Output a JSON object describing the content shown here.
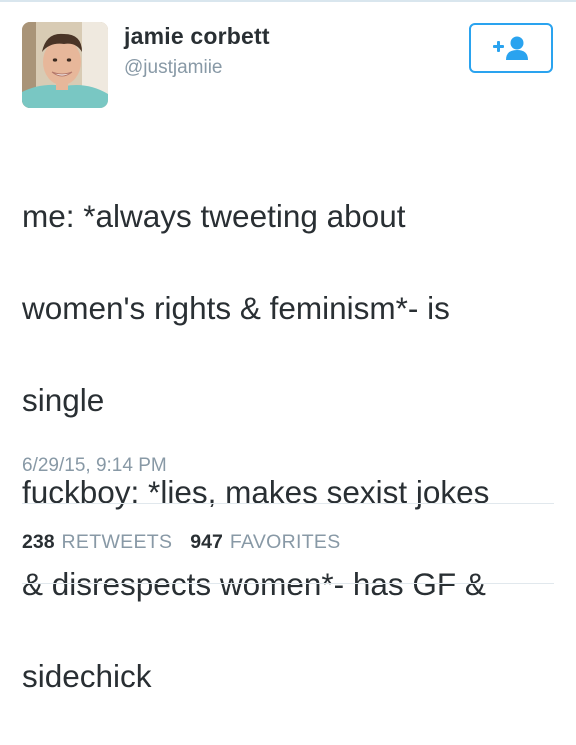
{
  "profile": {
    "name": "jamie corbett",
    "handle": "@justjamiie",
    "avatar_icon": "profile-photo"
  },
  "follow_button": {
    "icon": "follow-user-icon",
    "accent": "#2aa3ef"
  },
  "tweet": {
    "lines": [
      "me: *always tweeting about",
      "women's rights & feminism*- is",
      "single",
      "fuckboy: *lies, makes sexist jokes",
      "& disrespects women*- has GF &",
      "sidechick"
    ],
    "timestamp": "6/29/15, 9:14 PM"
  },
  "stats": {
    "retweets_count": "238",
    "retweets_label": "RETWEETS",
    "favorites_count": "947",
    "favorites_label": "FAVORITES"
  }
}
